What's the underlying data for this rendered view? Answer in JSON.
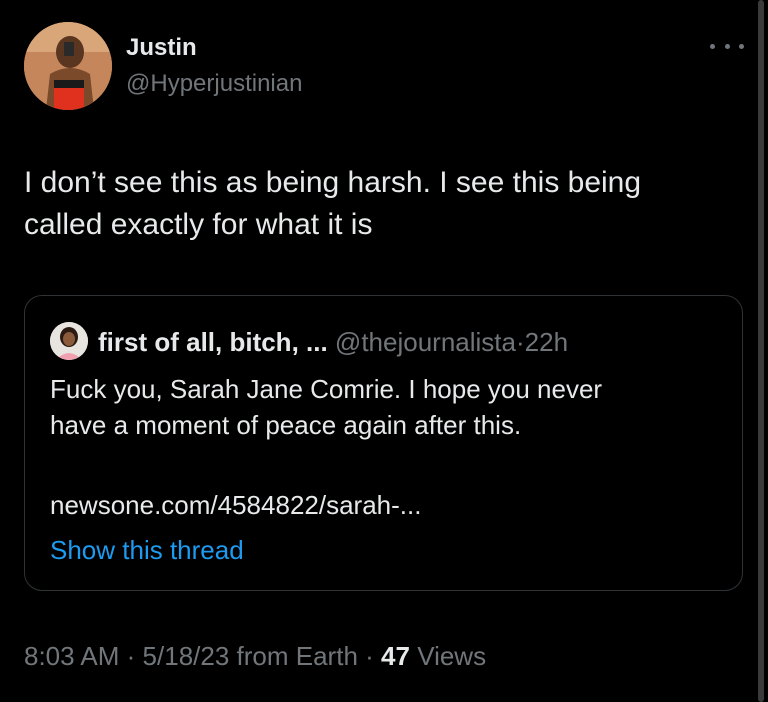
{
  "author": {
    "display_name": "Justin",
    "handle": "@Hyperjustinian",
    "avatar_icon": "profile-photo"
  },
  "tweet": {
    "text_line_1": "I don’t see this as being harsh. I see this being",
    "text_line_2": "called exactly for what it is"
  },
  "quoted_tweet": {
    "display_name": "first of all, bitch, ...",
    "handle": "@thejournalista",
    "separator": "·",
    "age": "22h",
    "text_line_1": "Fuck you, Sarah Jane Comrie. I hope you never",
    "text_line_2": "have a moment of peace again after this.",
    "link": "newsone.com/4584822/sarah-...",
    "show_thread": "Show this thread"
  },
  "meta": {
    "time": "8:03 AM",
    "separator": "·",
    "date": "5/18/23",
    "source": "from Earth",
    "views_count": "47",
    "views_label": "Views"
  },
  "colors": {
    "background": "#000000",
    "primary_text": "#e7e9ea",
    "secondary_text": "#71767b",
    "link": "#1d9bf0",
    "border": "#2f3336"
  }
}
